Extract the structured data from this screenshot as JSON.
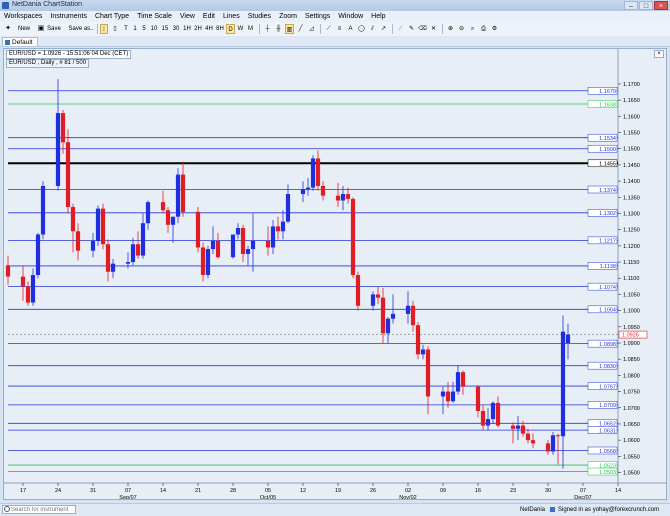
{
  "window": {
    "title": "NetDania ChartStation",
    "buttons": [
      "–",
      "□",
      "×"
    ]
  },
  "menu": [
    "Workspaces",
    "Instruments",
    "Chart Type",
    "Time Scale",
    "View",
    "Edit",
    "Lines",
    "Studies",
    "Zoom",
    "Settings",
    "Window",
    "Help"
  ],
  "toolbar": {
    "new": "New",
    "save": "Save",
    "save_as": "Save as..",
    "periods": [
      "T",
      "1",
      "5",
      "10",
      "15",
      "30",
      "1H",
      "2H",
      "4H",
      "8H",
      "D",
      "W",
      "M"
    ],
    "selected_period": "D"
  },
  "tab": {
    "label": "Default"
  },
  "chart": {
    "instrument_label": "EUR/USD = 1.0926 - 15:51:06  04 Dec (CET)",
    "series_label": "EUR/USD , Daily , # 81 / 500",
    "current_price": "1.0926",
    "colors": {
      "up": "#1f2fe0",
      "down": "#e01c24",
      "blue_line": "#2336d6",
      "green_line": "#27c24a",
      "black_line": "#000000",
      "current_line": "#777777"
    },
    "y_ticks": [
      "1.1700",
      "1.1650",
      "1.1600",
      "1.1550",
      "1.1500",
      "1.1450",
      "1.1400",
      "1.1350",
      "1.1300",
      "1.1250",
      "1.1200",
      "1.1150",
      "1.1100",
      "1.1050",
      "1.1000",
      "1.0950",
      "1.0900",
      "1.0850",
      "1.0800",
      "1.0750",
      "1.0700",
      "1.0650",
      "1.0600",
      "1.0550",
      "1.0500"
    ],
    "x_ticks": [
      "17",
      "24",
      "31",
      "07",
      "14",
      "21",
      "28",
      "05",
      "12",
      "19",
      "26",
      "02",
      "09",
      "16",
      "23",
      "30",
      "07",
      "14"
    ],
    "x_month_labels": [
      {
        "label": "Sep/07",
        "at": "07"
      },
      {
        "label": "Oct/05",
        "at": "05"
      },
      {
        "label": "Nov/02",
        "at": "02"
      },
      {
        "label": "Dec/07",
        "at": "07b"
      }
    ],
    "lines": [
      {
        "value": 1.1679,
        "color": "blue",
        "label": "1.1679"
      },
      {
        "value": 1.1638,
        "color": "green",
        "label": "1.1638"
      },
      {
        "value": 1.1534,
        "color": "blue",
        "label": "1.1534"
      },
      {
        "value": 1.15,
        "color": "blue",
        "label": "1.1500"
      },
      {
        "value": 1.1455,
        "color": "black",
        "label": "1.1455"
      },
      {
        "value": 1.1374,
        "color": "blue",
        "label": "1.1374"
      },
      {
        "value": 1.1302,
        "color": "blue",
        "label": "1.1302"
      },
      {
        "value": 1.1217,
        "color": "blue",
        "label": "1.1217"
      },
      {
        "value": 1.1138,
        "color": "blue",
        "label": "1.1138"
      },
      {
        "value": 1.1074,
        "color": "blue",
        "label": "1.1074"
      },
      {
        "value": 1.1004,
        "color": "blue",
        "label": "1.1004"
      },
      {
        "value": 1.0898,
        "color": "blue",
        "label": "1.0898"
      },
      {
        "value": 1.083,
        "color": "blue",
        "label": "1.0830"
      },
      {
        "value": 1.0767,
        "color": "blue",
        "label": "1.0767"
      },
      {
        "value": 1.0709,
        "color": "blue",
        "label": "1.0709"
      },
      {
        "value": 1.0652,
        "color": "blue",
        "label": "1.0652"
      },
      {
        "value": 1.0631,
        "color": "blue",
        "label": "1.0631"
      },
      {
        "value": 1.0568,
        "color": "blue",
        "label": "1.0568"
      },
      {
        "value": 1.0523,
        "color": "green",
        "label": "1.0523"
      },
      {
        "value": 1.0503,
        "color": "green",
        "label": "1.0503"
      }
    ]
  },
  "chart_data": {
    "type": "candlestick",
    "instrument": "EUR/USD",
    "y_range": [
      1.048,
      1.174
    ],
    "x_start": "2015-08-14",
    "x_end": "2015-12-14",
    "candles": [
      {
        "d": "2015-08-14",
        "o": 1.114,
        "h": 1.117,
        "l": 1.108,
        "c": 1.1105
      },
      {
        "d": "2015-08-17",
        "o": 1.1105,
        "h": 1.114,
        "l": 1.103,
        "c": 1.1075
      },
      {
        "d": "2015-08-18",
        "o": 1.1075,
        "h": 1.109,
        "l": 1.1015,
        "c": 1.1025
      },
      {
        "d": "2015-08-19",
        "o": 1.1025,
        "h": 1.113,
        "l": 1.1015,
        "c": 1.111
      },
      {
        "d": "2015-08-20",
        "o": 1.111,
        "h": 1.124,
        "l": 1.11,
        "c": 1.1235
      },
      {
        "d": "2015-08-21",
        "o": 1.1235,
        "h": 1.14,
        "l": 1.122,
        "c": 1.1385
      },
      {
        "d": "2015-08-24",
        "o": 1.1385,
        "h": 1.1715,
        "l": 1.137,
        "c": 1.161
      },
      {
        "d": "2015-08-25",
        "o": 1.161,
        "h": 1.162,
        "l": 1.1485,
        "c": 1.152
      },
      {
        "d": "2015-08-26",
        "o": 1.152,
        "h": 1.156,
        "l": 1.13,
        "c": 1.132
      },
      {
        "d": "2015-08-27",
        "o": 1.132,
        "h": 1.133,
        "l": 1.118,
        "c": 1.1245
      },
      {
        "d": "2015-08-28",
        "o": 1.1245,
        "h": 1.127,
        "l": 1.1155,
        "c": 1.1185
      },
      {
        "d": "2015-08-31",
        "o": 1.1185,
        "h": 1.124,
        "l": 1.1165,
        "c": 1.1215
      },
      {
        "d": "2015-09-01",
        "o": 1.1215,
        "h": 1.1325,
        "l": 1.12,
        "c": 1.1315
      },
      {
        "d": "2015-09-02",
        "o": 1.1315,
        "h": 1.133,
        "l": 1.119,
        "c": 1.1205
      },
      {
        "d": "2015-09-03",
        "o": 1.1205,
        "h": 1.122,
        "l": 1.109,
        "c": 1.112
      },
      {
        "d": "2015-09-04",
        "o": 1.112,
        "h": 1.116,
        "l": 1.11,
        "c": 1.1145
      },
      {
        "d": "2015-09-07",
        "o": 1.1145,
        "h": 1.118,
        "l": 1.113,
        "c": 1.115
      },
      {
        "d": "2015-09-08",
        "o": 1.115,
        "h": 1.1225,
        "l": 1.114,
        "c": 1.1205
      },
      {
        "d": "2015-09-09",
        "o": 1.1205,
        "h": 1.1245,
        "l": 1.116,
        "c": 1.117
      },
      {
        "d": "2015-09-10",
        "o": 1.117,
        "h": 1.13,
        "l": 1.116,
        "c": 1.127
      },
      {
        "d": "2015-09-11",
        "o": 1.127,
        "h": 1.134,
        "l": 1.125,
        "c": 1.1335
      },
      {
        "d": "2015-09-14",
        "o": 1.1335,
        "h": 1.137,
        "l": 1.13,
        "c": 1.131
      },
      {
        "d": "2015-09-15",
        "o": 1.131,
        "h": 1.132,
        "l": 1.124,
        "c": 1.1265
      },
      {
        "d": "2015-09-16",
        "o": 1.1265,
        "h": 1.129,
        "l": 1.121,
        "c": 1.129
      },
      {
        "d": "2015-09-17",
        "o": 1.129,
        "h": 1.144,
        "l": 1.127,
        "c": 1.142
      },
      {
        "d": "2015-09-18",
        "o": 1.142,
        "h": 1.146,
        "l": 1.129,
        "c": 1.1305
      },
      {
        "d": "2015-09-21",
        "o": 1.1305,
        "h": 1.132,
        "l": 1.118,
        "c": 1.1195
      },
      {
        "d": "2015-09-22",
        "o": 1.1195,
        "h": 1.121,
        "l": 1.109,
        "c": 1.111
      },
      {
        "d": "2015-09-23",
        "o": 1.111,
        "h": 1.12,
        "l": 1.11,
        "c": 1.119
      },
      {
        "d": "2015-09-24",
        "o": 1.119,
        "h": 1.126,
        "l": 1.1175,
        "c": 1.1215
      },
      {
        "d": "2015-09-25",
        "o": 1.1215,
        "h": 1.124,
        "l": 1.116,
        "c": 1.1165
      },
      {
        "d": "2015-09-28",
        "o": 1.1165,
        "h": 1.1235,
        "l": 1.116,
        "c": 1.1235
      },
      {
        "d": "2015-09-29",
        "o": 1.1235,
        "h": 1.127,
        "l": 1.122,
        "c": 1.1255
      },
      {
        "d": "2015-09-30",
        "o": 1.1255,
        "h": 1.1265,
        "l": 1.115,
        "c": 1.1175
      },
      {
        "d": "2015-10-01",
        "o": 1.1175,
        "h": 1.12,
        "l": 1.114,
        "c": 1.119
      },
      {
        "d": "2015-10-02",
        "o": 1.119,
        "h": 1.13,
        "l": 1.112,
        "c": 1.1215
      },
      {
        "d": "2015-10-05",
        "o": 1.1215,
        "h": 1.126,
        "l": 1.117,
        "c": 1.1195
      },
      {
        "d": "2015-10-06",
        "o": 1.1195,
        "h": 1.128,
        "l": 1.1175,
        "c": 1.126
      },
      {
        "d": "2015-10-07",
        "o": 1.126,
        "h": 1.129,
        "l": 1.122,
        "c": 1.1245
      },
      {
        "d": "2015-10-08",
        "o": 1.1245,
        "h": 1.131,
        "l": 1.122,
        "c": 1.1275
      },
      {
        "d": "2015-10-09",
        "o": 1.1275,
        "h": 1.139,
        "l": 1.127,
        "c": 1.136
      },
      {
        "d": "2015-10-12",
        "o": 1.136,
        "h": 1.14,
        "l": 1.1335,
        "c": 1.1375
      },
      {
        "d": "2015-10-13",
        "o": 1.1375,
        "h": 1.141,
        "l": 1.1355,
        "c": 1.138
      },
      {
        "d": "2015-10-14",
        "o": 1.138,
        "h": 1.148,
        "l": 1.137,
        "c": 1.147
      },
      {
        "d": "2015-10-15",
        "o": 1.147,
        "h": 1.1495,
        "l": 1.137,
        "c": 1.1385
      },
      {
        "d": "2015-10-16",
        "o": 1.1385,
        "h": 1.14,
        "l": 1.134,
        "c": 1.1355
      },
      {
        "d": "2015-10-19",
        "o": 1.1355,
        "h": 1.1395,
        "l": 1.132,
        "c": 1.134
      },
      {
        "d": "2015-10-20",
        "o": 1.134,
        "h": 1.1385,
        "l": 1.131,
        "c": 1.136
      },
      {
        "d": "2015-10-21",
        "o": 1.136,
        "h": 1.138,
        "l": 1.133,
        "c": 1.1345
      },
      {
        "d": "2015-10-22",
        "o": 1.1345,
        "h": 1.135,
        "l": 1.11,
        "c": 1.111
      },
      {
        "d": "2015-10-23",
        "o": 1.111,
        "h": 1.112,
        "l": 1.1,
        "c": 1.1015
      },
      {
        "d": "2015-10-26",
        "o": 1.1015,
        "h": 1.106,
        "l": 1.1,
        "c": 1.105
      },
      {
        "d": "2015-10-27",
        "o": 1.105,
        "h": 1.1075,
        "l": 1.102,
        "c": 1.104
      },
      {
        "d": "2015-10-28",
        "o": 1.104,
        "h": 1.107,
        "l": 1.09,
        "c": 1.093
      },
      {
        "d": "2015-10-29",
        "o": 1.093,
        "h": 1.098,
        "l": 1.09,
        "c": 1.0975
      },
      {
        "d": "2015-10-30",
        "o": 1.0975,
        "h": 1.105,
        "l": 1.096,
        "c": 1.099
      },
      {
        "d": "2015-11-02",
        "o": 1.099,
        "h": 1.106,
        "l": 1.096,
        "c": 1.1015
      },
      {
        "d": "2015-11-03",
        "o": 1.1015,
        "h": 1.103,
        "l": 1.0935,
        "c": 1.0955
      },
      {
        "d": "2015-11-04",
        "o": 1.0955,
        "h": 1.0965,
        "l": 1.085,
        "c": 1.0865
      },
      {
        "d": "2015-11-05",
        "o": 1.0865,
        "h": 1.0895,
        "l": 1.085,
        "c": 1.088
      },
      {
        "d": "2015-11-06",
        "o": 1.088,
        "h": 1.089,
        "l": 1.068,
        "c": 1.0735
      },
      {
        "d": "2015-11-09",
        "o": 1.0735,
        "h": 1.0765,
        "l": 1.068,
        "c": 1.075
      },
      {
        "d": "2015-11-10",
        "o": 1.075,
        "h": 1.078,
        "l": 1.07,
        "c": 1.072
      },
      {
        "d": "2015-11-11",
        "o": 1.072,
        "h": 1.078,
        "l": 1.0715,
        "c": 1.075
      },
      {
        "d": "2015-11-12",
        "o": 1.075,
        "h": 1.083,
        "l": 1.074,
        "c": 1.081
      },
      {
        "d": "2015-11-13",
        "o": 1.081,
        "h": 1.0815,
        "l": 1.074,
        "c": 1.0765
      },
      {
        "d": "2015-11-16",
        "o": 1.0765,
        "h": 1.077,
        "l": 1.067,
        "c": 1.069
      },
      {
        "d": "2015-11-17",
        "o": 1.069,
        "h": 1.071,
        "l": 1.063,
        "c": 1.0645
      },
      {
        "d": "2015-11-18",
        "o": 1.0645,
        "h": 1.07,
        "l": 1.063,
        "c": 1.0665
      },
      {
        "d": "2015-11-19",
        "o": 1.0665,
        "h": 1.072,
        "l": 1.065,
        "c": 1.0715
      },
      {
        "d": "2015-11-20",
        "o": 1.0715,
        "h": 1.0735,
        "l": 1.064,
        "c": 1.0645
      },
      {
        "d": "2015-11-23",
        "o": 1.0645,
        "h": 1.0655,
        "l": 1.059,
        "c": 1.0635
      },
      {
        "d": "2015-11-24",
        "o": 1.0635,
        "h": 1.0675,
        "l": 1.06,
        "c": 1.0645
      },
      {
        "d": "2015-11-25",
        "o": 1.0645,
        "h": 1.066,
        "l": 1.061,
        "c": 1.062
      },
      {
        "d": "2015-11-26",
        "o": 1.062,
        "h": 1.0635,
        "l": 1.059,
        "c": 1.06
      },
      {
        "d": "2015-11-27",
        "o": 1.06,
        "h": 1.062,
        "l": 1.0575,
        "c": 1.059
      },
      {
        "d": "2015-11-30",
        "o": 1.059,
        "h": 1.06,
        "l": 1.0555,
        "c": 1.0565
      },
      {
        "d": "2015-12-01",
        "o": 1.0565,
        "h": 1.0625,
        "l": 1.0555,
        "c": 1.0615
      },
      {
        "d": "2015-12-02",
        "o": 1.0615,
        "h": 1.062,
        "l": 1.0525,
        "c": 1.0612
      },
      {
        "d": "2015-12-03",
        "o": 1.0612,
        "h": 1.0985,
        "l": 1.0512,
        "c": 1.0935
      },
      {
        "d": "2015-12-04",
        "o": 1.09,
        "h": 1.096,
        "l": 1.085,
        "c": 1.0926
      }
    ]
  },
  "statusbar": {
    "search_placeholder": "Search for instrument",
    "provider": "NetDania",
    "signed_in": "Signed in as yohay@forexcrunch.com"
  }
}
